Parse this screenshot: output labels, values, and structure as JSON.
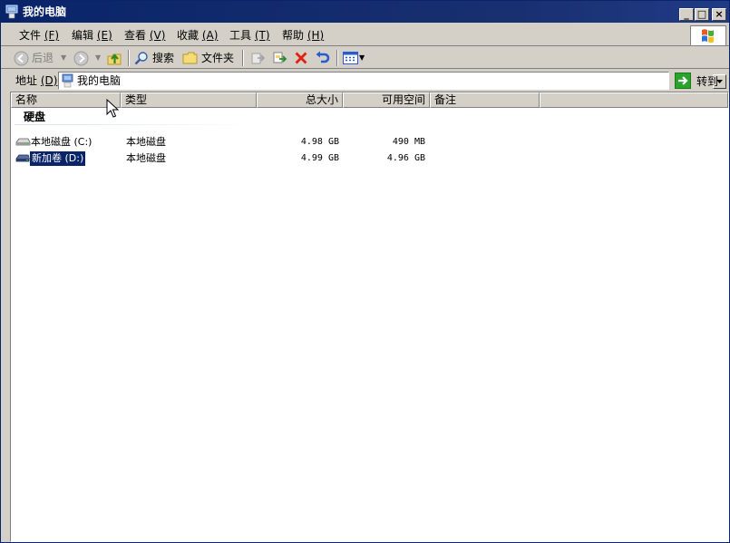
{
  "window": {
    "title": "我的电脑",
    "min_glyph": "_",
    "max_glyph": "□",
    "close_glyph": "×"
  },
  "menu": [
    {
      "label": "文件",
      "key": "(F)"
    },
    {
      "label": "编辑",
      "key": "(E)"
    },
    {
      "label": "查看",
      "key": "(V)"
    },
    {
      "label": "收藏",
      "key": "(A)"
    },
    {
      "label": "工具",
      "key": "(T)"
    },
    {
      "label": "帮助",
      "key": "(H)"
    }
  ],
  "toolbar": {
    "back_label": "后退",
    "search_label": "搜索",
    "folders_label": "文件夹"
  },
  "address": {
    "label": "地址",
    "key": "(D)",
    "value": "我的电脑",
    "go_label": "转到"
  },
  "columns": {
    "name": "名称",
    "type": "类型",
    "total": "总大小",
    "free": "可用空间",
    "comment": "备注"
  },
  "group": {
    "label": "硬盘"
  },
  "drives": [
    {
      "name": "本地磁盘 (C:)",
      "type": "本地磁盘",
      "total": "4.98 GB",
      "free": "490 MB"
    },
    {
      "name": "新加卷 (D:)",
      "type": "本地磁盘",
      "total": "4.99 GB",
      "free": "4.96 GB"
    }
  ],
  "colors": {
    "titlebar": "#0a246a",
    "face": "#d4d0c8",
    "selection": "#0a246a"
  }
}
